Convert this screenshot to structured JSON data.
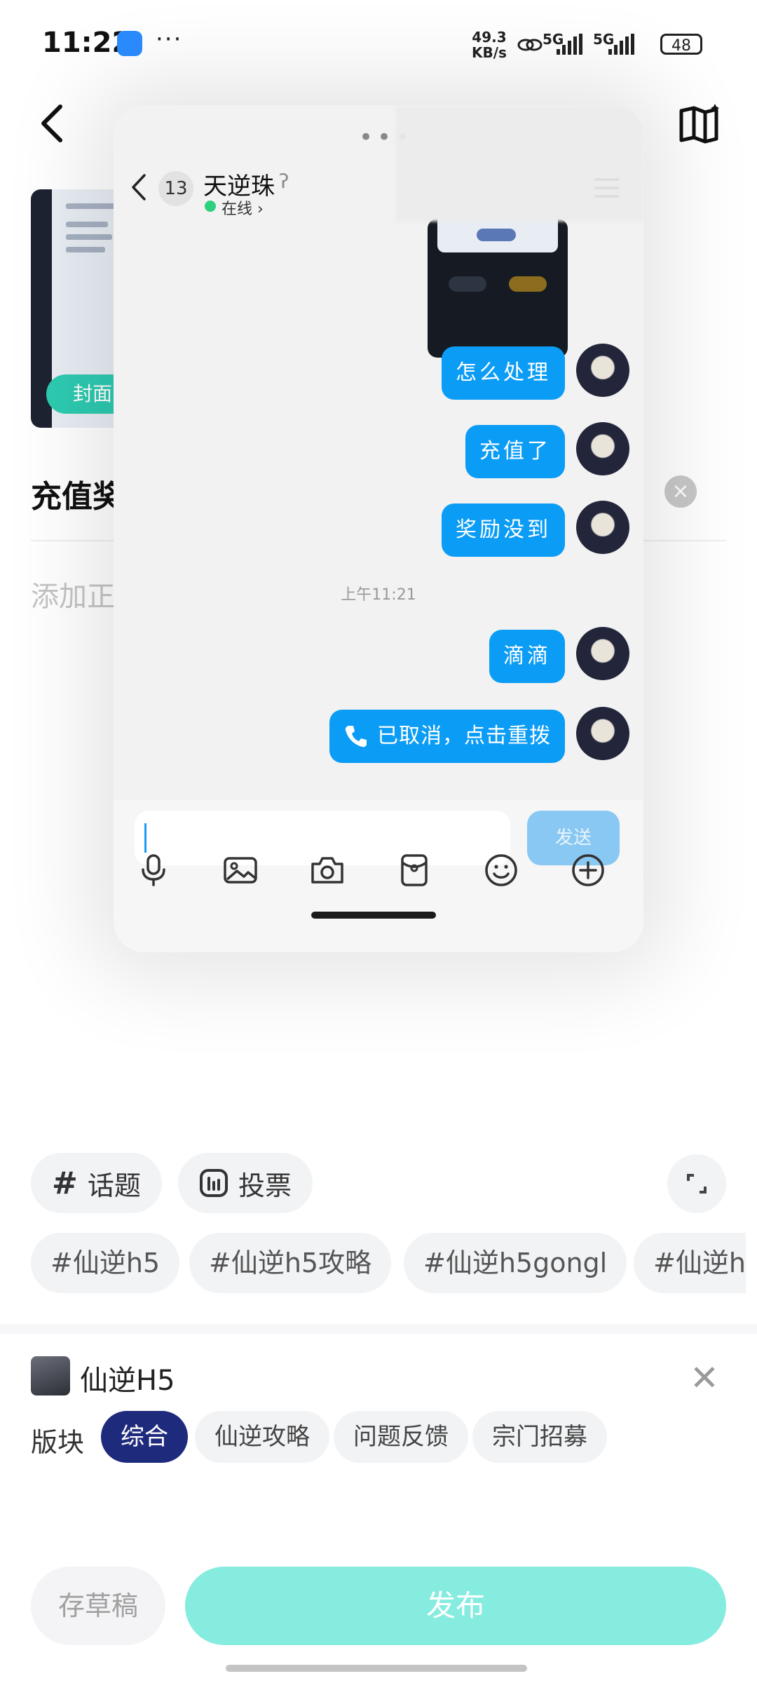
{
  "status_bar": {
    "time": "11:22",
    "ellipsis": "···",
    "net_speed_value": "49.3",
    "net_speed_unit": "KB/s",
    "sim1": "5G",
    "sim2": "5G",
    "battery": "48"
  },
  "editor": {
    "cover_badge": "封面",
    "title_text": "充值奖",
    "body_placeholder": "添加正",
    "clear_icon": "×",
    "topic_button": "话题",
    "topic_icon": "#",
    "vote_button": "投票",
    "suggested_tags": [
      "#仙逆h5",
      "#仙逆h5攻略",
      "#仙逆h5gongl",
      "#仙逆h"
    ],
    "game_name": "仙逆H5",
    "block_label": "版块",
    "blocks": [
      "综合",
      "仙逆攻略",
      "问题反馈",
      "宗门招募"
    ],
    "active_block": "综合",
    "draft_button": "存草稿",
    "publish_button": "发布"
  },
  "chat": {
    "grab_dots": "•••",
    "unread_count": "13",
    "contact_name": "天逆珠",
    "status": "在线",
    "messages": [
      {
        "text": "怎么处理"
      },
      {
        "text": "充值了"
      },
      {
        "text": "奖励没到"
      },
      {
        "text": "滴滴"
      },
      {
        "text": "已取消，点击重拨"
      }
    ],
    "time_separator": "上午11:21",
    "send_button": "发送"
  },
  "colors": {
    "accent_teal": "#2ecbb2",
    "publish_teal": "#86ece0",
    "bubble_blue": "#0b9cf5",
    "active_block_navy": "#1e2a7c"
  }
}
